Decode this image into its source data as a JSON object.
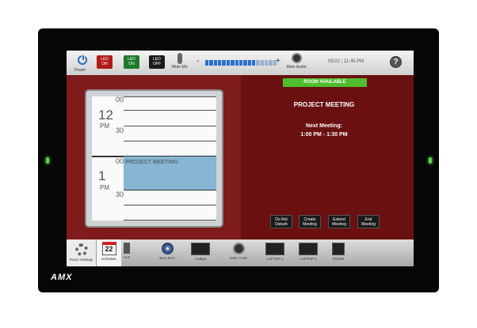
{
  "topbar": {
    "power_label": "Power",
    "led_buttons": [
      {
        "line1": "LED",
        "line2": "ON",
        "color": "#b21a1a"
      },
      {
        "line1": "LED",
        "line2": "ON",
        "color": "#1e7a2a"
      },
      {
        "line1": "LED",
        "line2": "OFF",
        "color": "#1a1a1a"
      }
    ],
    "mute_mic_label": "Mute Mic",
    "volume_minus": "-",
    "volume_plus": "+",
    "mute_audio_label": "Mute Audio",
    "date": "05/22",
    "time": "11:45 PM",
    "help_icon": "question-icon"
  },
  "calendar": {
    "hour1": "12",
    "ampm1": "PM",
    "hour2": "1",
    "ampm2": "PM",
    "min_00": "00",
    "min_30": "30",
    "meeting_label": "PROJECT MEETING"
  },
  "status": {
    "room_status": "ROOM AVAILABLE",
    "room_status_color": "#4fbd2e",
    "current_meeting": "PROJECT MEETING",
    "next_meeting_heading": "Next Meeting:",
    "next_meeting_time": "1:00 PM - 1:30 PM"
  },
  "actions": {
    "do_not_disturb": [
      "Do Not",
      "Disturb"
    ],
    "create_meeting": [
      "Create",
      "Meeting"
    ],
    "extend_meeting": [
      "Extend",
      "Meeting"
    ],
    "end_meeting": [
      "End",
      "Meeting"
    ]
  },
  "bottombar": {
    "settings_label": "Room Settings",
    "schedule_label": "Schedule",
    "schedule_day": "22",
    "sources": [
      "ALS",
      "BLU-RAY",
      "CABLE",
      "DOC CAM",
      "LAPTOP 1",
      "LAPTOP 2",
      "ROOM"
    ]
  },
  "brand": "AMX"
}
